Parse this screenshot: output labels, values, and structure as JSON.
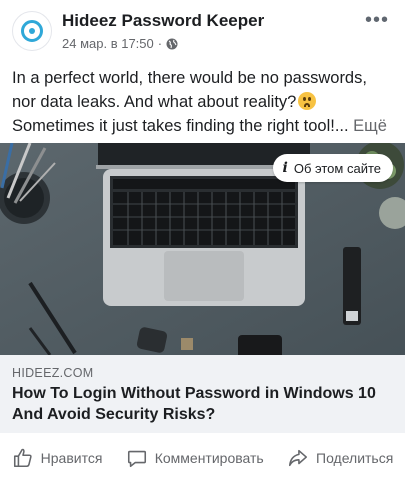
{
  "post": {
    "page_name": "Hideez Password Keeper",
    "timestamp": "24 мар. в 17:50",
    "separator": "·",
    "audience_icon": "globe-icon",
    "more_label": "•••",
    "text_lines": [
      "In a perfect world, there would be no passwords,",
      "nor data leaks. And what about reality?",
      "Sometimes it just takes finding the right tool!..."
    ],
    "see_more": "Ещё",
    "emoji": "worried-face-emoji"
  },
  "image": {
    "about_label": "Об этом сайте",
    "about_icon": "info-icon"
  },
  "link": {
    "domain": "HIDEEZ.COM",
    "title": "How To Login Without Password in Windows 10 And Avoid Security Risks?"
  },
  "actions": {
    "like_label": "Нравится",
    "comment_label": "Комментировать",
    "share_label": "Поделиться"
  },
  "colors": {
    "accent": "#2fa8d8",
    "secondary_text": "#65676b",
    "link_card_bg": "#f0f2f5"
  }
}
